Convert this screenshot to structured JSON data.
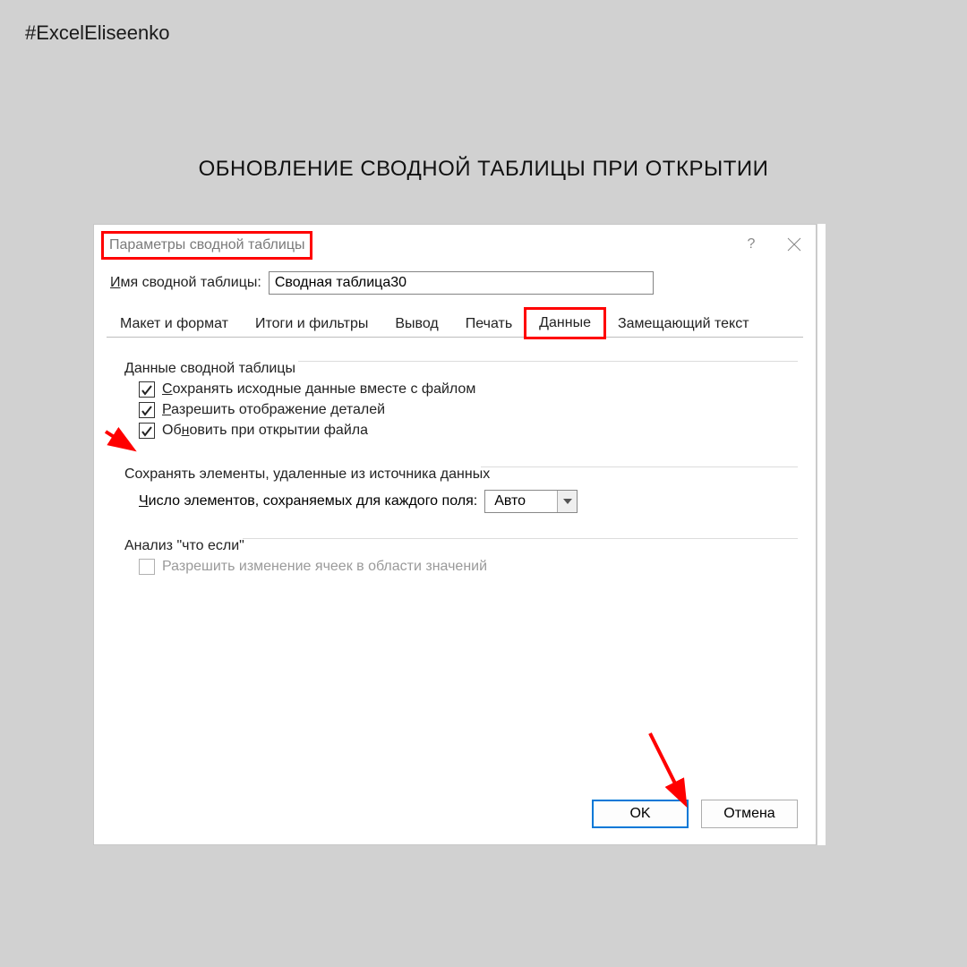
{
  "page": {
    "hashtag": "#ExcelEliseenko",
    "heading": "ОБНОВЛЕНИЕ СВОДНОЙ ТАБЛИЦЫ ПРИ ОТКРЫТИИ"
  },
  "dialog": {
    "title": "Параметры сводной таблицы",
    "help": "?",
    "name_label_pre": "И",
    "name_label_rest": "мя сводной таблицы:",
    "name_value": "Сводная таблица30",
    "tabs": [
      {
        "label": "Макет и формат"
      },
      {
        "label": "Итоги и фильтры"
      },
      {
        "label": "Вывод"
      },
      {
        "label": "Печать"
      },
      {
        "label": "Данные"
      },
      {
        "label": "Замещающий текст"
      }
    ],
    "group1": {
      "title": "Данные сводной таблицы",
      "check1_pre": "С",
      "check1_rest": "охранять исходные данные вместе с файлом",
      "check2_pre": "Р",
      "check2_rest": "азрешить отображение деталей",
      "check3_pre": "Об",
      "check3_u": "н",
      "check3_rest": "овить при открытии файла"
    },
    "group2": {
      "title": "Сохранять элементы, удаленные из источника данных",
      "combo_label_pre": "Ч",
      "combo_label_rest": "исло элементов, сохраняемых для каждого поля:",
      "combo_value": "Авто"
    },
    "group3": {
      "title": "Анализ \"что если\"",
      "check_label": "Разрешить изменение ячеек в области значений"
    },
    "buttons": {
      "ok": "OK",
      "cancel": "Отмена"
    }
  }
}
